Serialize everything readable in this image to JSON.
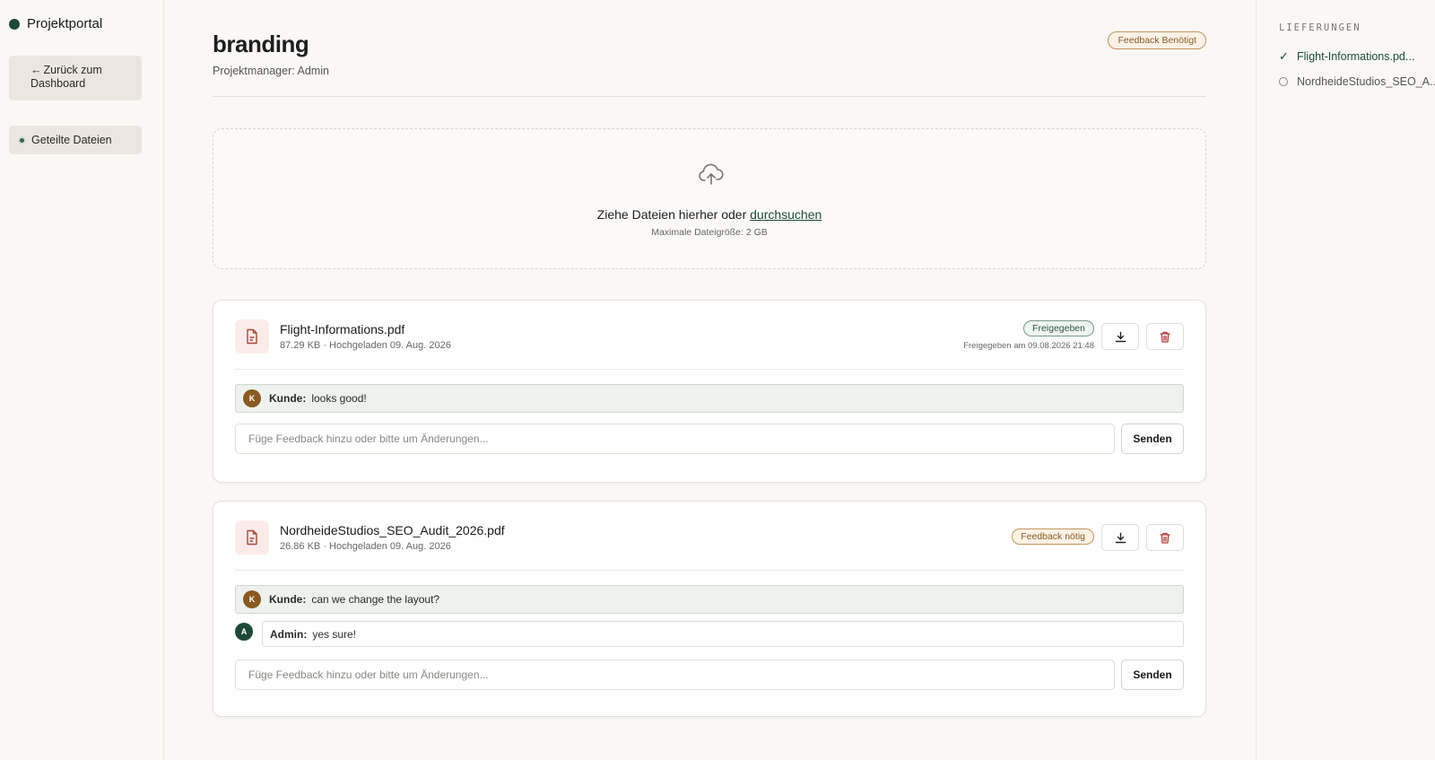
{
  "sidebar": {
    "brand": "Projektportal",
    "back_arrow": "←",
    "back_label": "Zurück zum Dashboard",
    "nav": [
      {
        "label": "Geteilte Dateien"
      }
    ]
  },
  "header": {
    "title": "branding",
    "subtitle": "Projektmanager: Admin",
    "badge": "Feedback Benötigt"
  },
  "upload": {
    "text": "Ziehe Dateien hierher oder",
    "link": "durchsuchen",
    "limit": "Maximale Dateigröße: 2 GB"
  },
  "files": [
    {
      "name": "Flight-Informations.pdf",
      "meta": "87.29 KB · Hochgeladen 09. Aug. 2026",
      "status": "Freigegeben",
      "status_note": "Freigegeben am 09.08.2026 21:48",
      "comments": [
        {
          "avatar": "K",
          "author": "Kunde:",
          "text": "looks good!"
        }
      ],
      "input_placeholder": "Füge Feedback hinzu oder bitte um Änderungen...",
      "send_label": "Senden"
    },
    {
      "name": "NordheideStudios_SEO_Audit_2026.pdf",
      "meta": "26.86 KB · Hochgeladen 09. Aug. 2026",
      "status": "Feedback nötig",
      "comments": [
        {
          "avatar": "K",
          "author": "Kunde:",
          "text": "can we change the layout?"
        },
        {
          "avatar": "A",
          "author": "Admin:",
          "text": "yes sure!"
        }
      ],
      "input_placeholder": "Füge Feedback hinzu oder bitte um Änderungen...",
      "send_label": "Senden"
    }
  ],
  "deliveries": {
    "heading": "LIEFERUNGEN",
    "items": [
      {
        "label": "Flight-Informations.pd...",
        "done": true,
        "mark": "✓"
      },
      {
        "label": "NordheideStudios_SEO_A...",
        "done": false
      }
    ]
  },
  "colors": {
    "accent": "#1d4a36",
    "warning": "#8a5a22",
    "danger": "#b03a3a",
    "background": "#faf8f5"
  },
  "icons": [
    "upload-cloud-icon",
    "file-document-icon",
    "download-icon",
    "trash-icon",
    "check-icon",
    "circle-icon"
  ]
}
